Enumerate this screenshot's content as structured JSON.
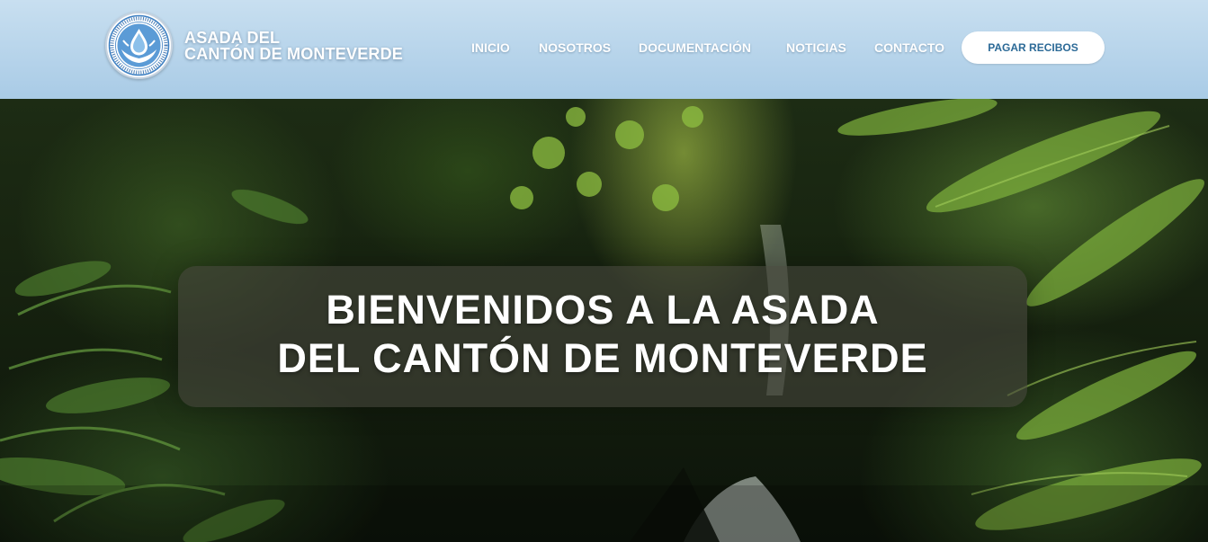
{
  "header": {
    "brand_line1": "ASADA DEL",
    "brand_line2": "CANTÓN DE MONTEVERDE",
    "nav": [
      "INICIO",
      "NOSOTROS",
      "DOCUMENTACIÓN",
      "NOTICIAS",
      "CONTACTO"
    ],
    "pay_button": "PAGAR RECIBOS",
    "colors": {
      "header_top": "#c8dff0",
      "header_bottom": "#a9cbe6",
      "button_text": "#2c6a97"
    }
  },
  "hero": {
    "title_line1": "BIENVENIDOS A LA ASADA",
    "title_line2": "DEL CANTÓN DE MONTEVERDE",
    "background": "rainforest-waterfall-photo"
  },
  "logo": {
    "icon": "asada-water-drop-hands-seal"
  }
}
